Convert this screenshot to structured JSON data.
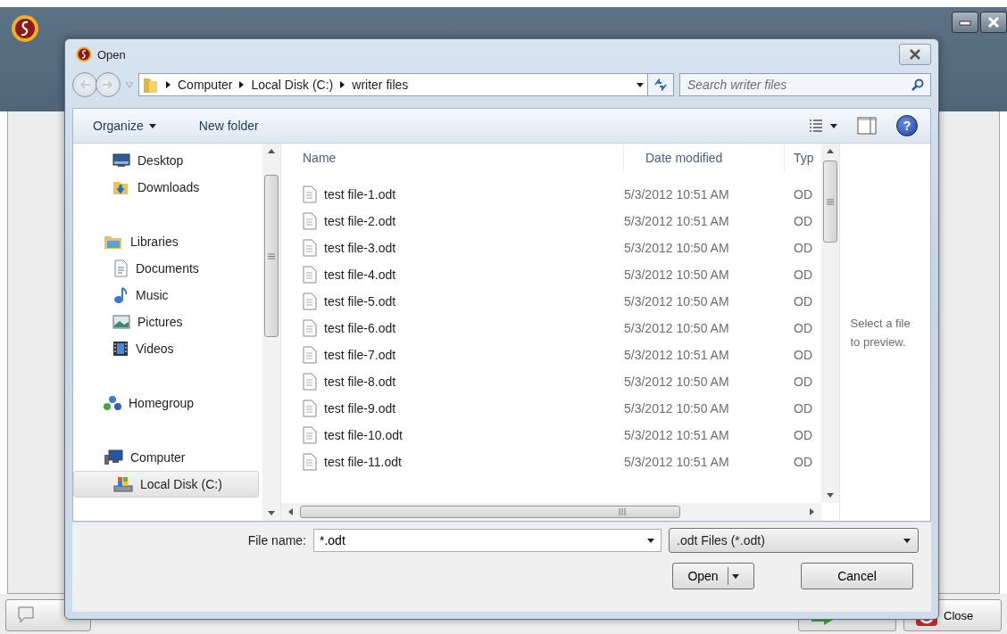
{
  "app": {
    "buttons": [
      {
        "kind": "help"
      },
      {
        "kind": "next"
      },
      {
        "kind": "close",
        "label": "Close"
      }
    ]
  },
  "dialog": {
    "title": "Open",
    "breadcrumb": [
      "Computer",
      "Local Disk (C:)",
      "writer files"
    ],
    "search": {
      "placeholder": "Search writer files"
    },
    "toolbar": [
      "Organize",
      "New folder"
    ],
    "help_symbol": "?",
    "nav": [
      {
        "label": "Desktop",
        "kind": "favorite",
        "selected": false
      },
      {
        "label": "Downloads",
        "kind": "favorite",
        "selected": false
      },
      {
        "label": "Libraries",
        "kind": "root",
        "selected": false,
        "children": [
          {
            "label": "Documents",
            "selected": false
          },
          {
            "label": "Music",
            "selected": false
          },
          {
            "label": "Pictures",
            "selected": false
          },
          {
            "label": "Videos",
            "selected": false
          }
        ]
      },
      {
        "label": "Homegroup",
        "kind": "root",
        "selected": false
      },
      {
        "label": "Computer",
        "kind": "root",
        "selected": false,
        "children": [
          {
            "label": "Local Disk (C:)",
            "selected": true
          }
        ]
      }
    ],
    "columns": [
      "Name",
      "Date modified",
      "Typ"
    ],
    "files": [
      {
        "name": "test file-1.odt",
        "date": "5/3/2012 10:51 AM",
        "type": "OD"
      },
      {
        "name": "test file-2.odt",
        "date": "5/3/2012 10:51 AM",
        "type": "OD"
      },
      {
        "name": "test file-3.odt",
        "date": "5/3/2012 10:50 AM",
        "type": "OD"
      },
      {
        "name": "test file-4.odt",
        "date": "5/3/2012 10:50 AM",
        "type": "OD"
      },
      {
        "name": "test file-5.odt",
        "date": "5/3/2012 10:50 AM",
        "type": "OD"
      },
      {
        "name": "test file-6.odt",
        "date": "5/3/2012 10:50 AM",
        "type": "OD"
      },
      {
        "name": "test file-7.odt",
        "date": "5/3/2012 10:51 AM",
        "type": "OD"
      },
      {
        "name": "test file-8.odt",
        "date": "5/3/2012 10:50 AM",
        "type": "OD"
      },
      {
        "name": "test file-9.odt",
        "date": "5/3/2012 10:50 AM",
        "type": "OD"
      },
      {
        "name": "test file-10.odt",
        "date": "5/3/2012 10:51 AM",
        "type": "OD"
      },
      {
        "name": "test file-11.odt",
        "date": "5/3/2012 10:51 AM",
        "type": "OD"
      }
    ],
    "preview": "Select a file to preview.",
    "file_name": {
      "label": "File name:",
      "value": "*.odt"
    },
    "file_type": ".odt Files (*.odt)",
    "buttons": [
      "Open",
      "Cancel"
    ]
  }
}
